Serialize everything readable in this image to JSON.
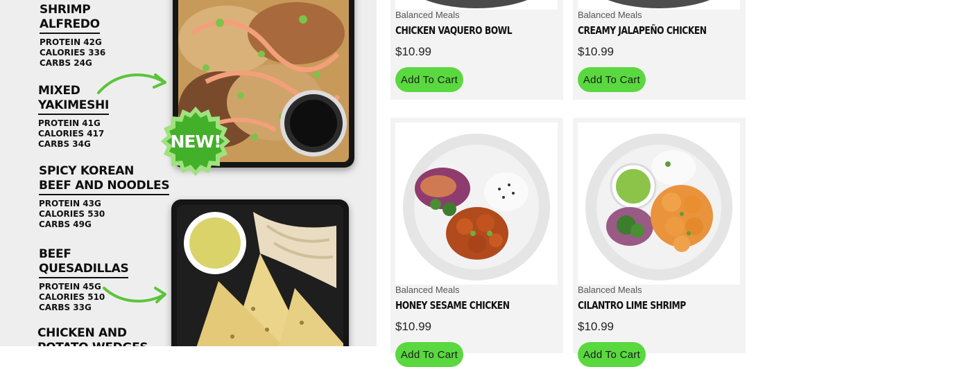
{
  "banner": {
    "new_badge": "NEW!",
    "meals": [
      {
        "name_line1": "SHRIMP",
        "name_line2": "ALFREDO",
        "protein": "PROTEIN 42G",
        "calories": "CALORIES 336",
        "carbs": "CARBS 24G"
      },
      {
        "name_line1": "MIXED",
        "name_line2": "YAKIMESHI",
        "protein": "PROTEIN 41G",
        "calories": "CALORIES 417",
        "carbs": "CARBS 34G"
      },
      {
        "name_line1": "SPICY KOREAN",
        "name_line2": "BEEF AND NOODLES",
        "protein": "PROTEIN 43G",
        "calories": "CALORIES 530",
        "carbs": "CARBS 49G"
      },
      {
        "name_line1": "BEEF",
        "name_line2": "QUESADILLAS",
        "protein": "PROTEIN 45G",
        "calories": "CALORIES 510",
        "carbs": "CARBS 33G"
      },
      {
        "name_line1": "CHICKEN AND",
        "name_line2": "POTATO WEDGES",
        "protein": "",
        "calories": "",
        "carbs": ""
      }
    ],
    "colors": {
      "badge_green": "#43b02a",
      "arrow_green": "#5cc43a"
    }
  },
  "products": [
    {
      "category": "Balanced Meals",
      "title": "Chicken Vaquero Bowl",
      "price": "$10.99",
      "button": "Add To Cart"
    },
    {
      "category": "Balanced Meals",
      "title": "Creamy Jalapeño Chicken",
      "price": "$10.99",
      "button": "Add To Cart"
    },
    {
      "category": "Balanced Meals",
      "title": "Honey Sesame Chicken",
      "price": "$10.99",
      "button": "Add To Cart"
    },
    {
      "category": "Balanced Meals",
      "title": "Cilantro Lime Shrimp",
      "price": "$10.99",
      "button": "Add To Cart"
    }
  ],
  "colors": {
    "button_green": "#5ad83f",
    "card_bg": "#f3f3f3"
  }
}
